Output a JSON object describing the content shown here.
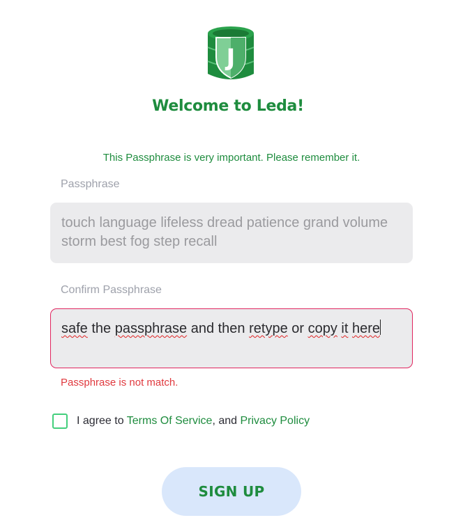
{
  "brand": {
    "logo_letter": "J",
    "logo_icon": "database-shield-icon",
    "colors": {
      "green": "#1e8c3e",
      "checkbox_border": "#43cf7c",
      "error": "#e0393e",
      "button_bg": "#d9e7fb"
    }
  },
  "header": {
    "title": "Welcome to Leda!"
  },
  "notice": "This Passphrase is very important. Please remember it.",
  "passphrase": {
    "label": "Passphrase",
    "value": "touch language lifeless dread patience grand volume storm best fog step recall"
  },
  "confirm": {
    "label": "Confirm Passphrase",
    "words": [
      "safe",
      " the ",
      "passphrase",
      " and then ",
      "retype",
      " or ",
      "copy",
      " ",
      "it",
      " ",
      "here"
    ],
    "error": "Passphrase is not match."
  },
  "agreement": {
    "prefix": "I agree to ",
    "terms_link": "Terms Of Service",
    "middle": ", and ",
    "privacy_link": "Privacy Policy"
  },
  "signup_button": "SIGN UP"
}
